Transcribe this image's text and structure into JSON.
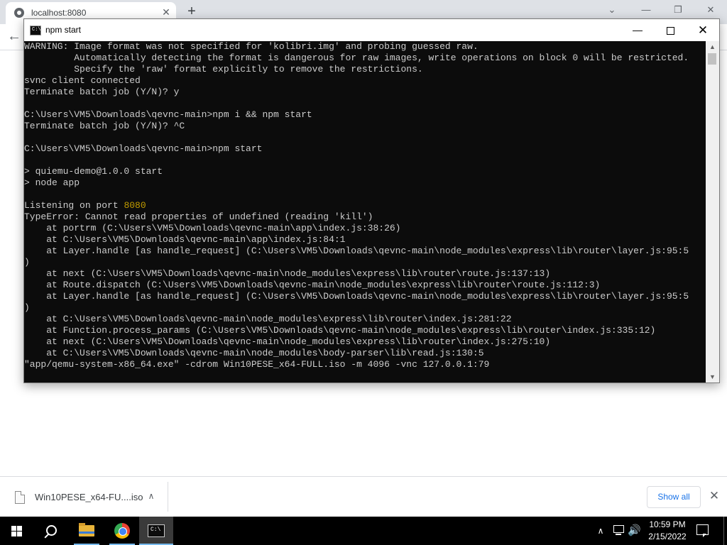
{
  "browser": {
    "tab_title": "localhost:8080",
    "tab_close": "✕",
    "new_tab": "+",
    "back_arrow": "←",
    "window_controls": {
      "dropdown": "⌄",
      "minimize": "—",
      "restore": "❐",
      "close": "✕"
    }
  },
  "console": {
    "title": "npm start",
    "icon_text": "C:\\",
    "controls": {
      "minimize": "—",
      "close": "✕"
    },
    "lines": [
      "WARNING: Image format was not specified for 'kolibri.img' and probing guessed raw.",
      "         Automatically detecting the format is dangerous for raw images, write operations on block 0 will be restricted.",
      "         Specify the 'raw' format explicitly to remove the restrictions.",
      "svnc client connected",
      "Terminate batch job (Y/N)? y",
      "",
      "C:\\Users\\VM5\\Downloads\\qevnc-main>npm i && npm start",
      "Terminate batch job (Y/N)? ^C",
      "",
      "C:\\Users\\VM5\\Downloads\\qevnc-main>npm start",
      "",
      "> quiemu-demo@1.0.0 start",
      "> node app",
      "",
      "Listening on port ",
      "TypeError: Cannot read properties of undefined (reading 'kill')",
      "    at portrm (C:\\Users\\VM5\\Downloads\\qevnc-main\\app\\index.js:38:26)",
      "    at C:\\Users\\VM5\\Downloads\\qevnc-main\\app\\index.js:84:1",
      "    at Layer.handle [as handle_request] (C:\\Users\\VM5\\Downloads\\qevnc-main\\node_modules\\express\\lib\\router\\layer.js:95:5",
      ")",
      "    at next (C:\\Users\\VM5\\Downloads\\qevnc-main\\node_modules\\express\\lib\\router\\route.js:137:13)",
      "    at Route.dispatch (C:\\Users\\VM5\\Downloads\\qevnc-main\\node_modules\\express\\lib\\router\\route.js:112:3)",
      "    at Layer.handle [as handle_request] (C:\\Users\\VM5\\Downloads\\qevnc-main\\node_modules\\express\\lib\\router\\layer.js:95:5",
      ")",
      "    at C:\\Users\\VM5\\Downloads\\qevnc-main\\node_modules\\express\\lib\\router\\index.js:281:22",
      "    at Function.process_params (C:\\Users\\VM5\\Downloads\\qevnc-main\\node_modules\\express\\lib\\router\\index.js:335:12)",
      "    at next (C:\\Users\\VM5\\Downloads\\qevnc-main\\node_modules\\express\\lib\\router\\index.js:275:10)",
      "    at C:\\Users\\VM5\\Downloads\\qevnc-main\\node_modules\\body-parser\\lib\\read.js:130:5",
      "\"app/qemu-system-x86_64.exe\" -cdrom Win10PESE_x64-FULL.iso -m 4096 -vnc 127.0.0.1:79"
    ],
    "highlight": {
      "line_index": 14,
      "text": "8080",
      "color": "#c19c00"
    },
    "scrollbar": {
      "up": "▲",
      "down": "▼"
    }
  },
  "downloads": {
    "filename": "Win10PESE_x64-FU....iso",
    "chevron": "∧",
    "show_all": "Show all",
    "close": "✕"
  },
  "taskbar": {
    "apps": [
      "file-explorer",
      "google-chrome",
      "command-prompt"
    ],
    "tray_chevron": "∧",
    "volume_icon": "🔊",
    "time": "10:59 PM",
    "date": "2/15/2022"
  },
  "colors": {
    "console_bg": "#0c0c0c",
    "console_text": "#cccccc",
    "taskbar_bg": "#000000",
    "accent": "#1a73e8"
  }
}
